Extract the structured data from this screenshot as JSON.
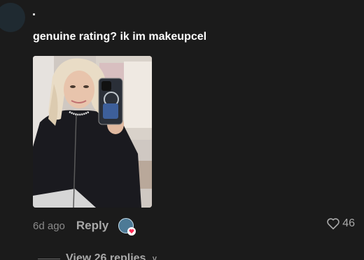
{
  "comment": {
    "username": ".",
    "text": "genuine rating? ik im makeupcel",
    "timestamp": "6d ago",
    "reply_label": "Reply",
    "like_count": "46",
    "avatar_icon": "user-avatar",
    "creator_like_icon": "creator-liked-badge"
  },
  "replies": {
    "label": "View 26 replies"
  },
  "colors": {
    "background": "#1b1b1b",
    "primary_text": "#ffffff",
    "secondary_text": "#8a8a8a",
    "action_text": "#a9a9a9",
    "heart_accent": "#fe2c55"
  }
}
